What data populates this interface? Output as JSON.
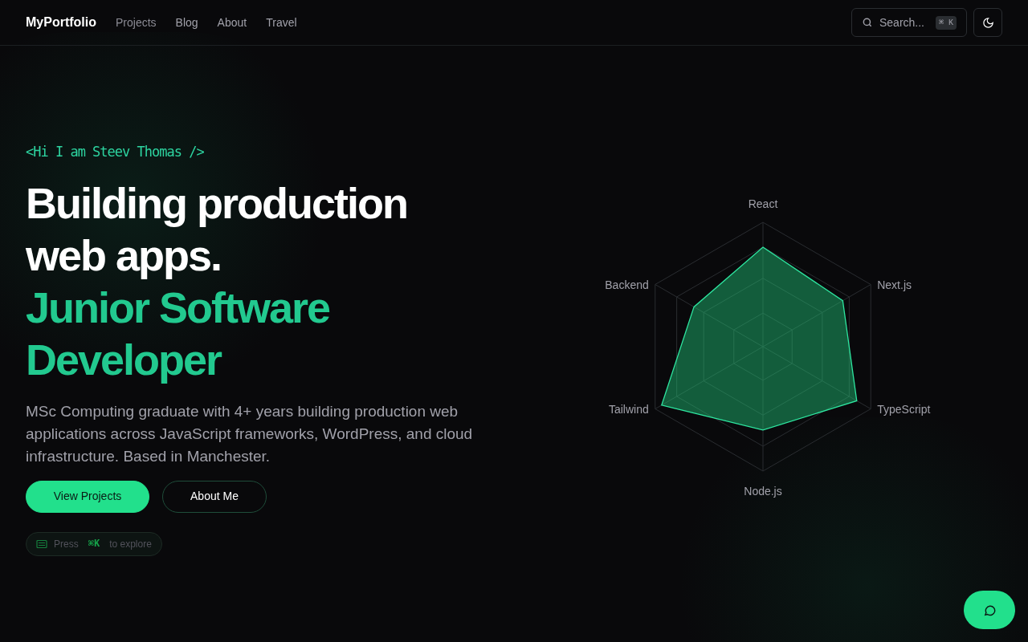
{
  "nav": {
    "brand": "MyPortfolio",
    "links": [
      "Projects",
      "Blog",
      "About",
      "Travel"
    ],
    "search": {
      "placeholder": "Search...",
      "shortcut": "⌘ K"
    }
  },
  "hero": {
    "tagline": "<Hi I am Steev Thomas />",
    "heading_lines": [
      "Building production",
      "web apps."
    ],
    "role_lines": [
      "Junior Software",
      "Developer"
    ],
    "description": "MSc Computing graduate with 4+ years building production web applications across JavaScript frameworks, WordPress, and cloud infrastructure. Based in Manchester.",
    "buttons": [
      {
        "label": "View Projects",
        "kind": "primary"
      },
      {
        "label": "About Me",
        "kind": "outline"
      }
    ],
    "hint": {
      "prefix": "Press",
      "key": "⌘K",
      "suffix": "to explore"
    }
  },
  "skills": [
    "React",
    "Next.js",
    "TypeScript",
    "Node.js",
    "Tailwind",
    "Backend"
  ]
}
